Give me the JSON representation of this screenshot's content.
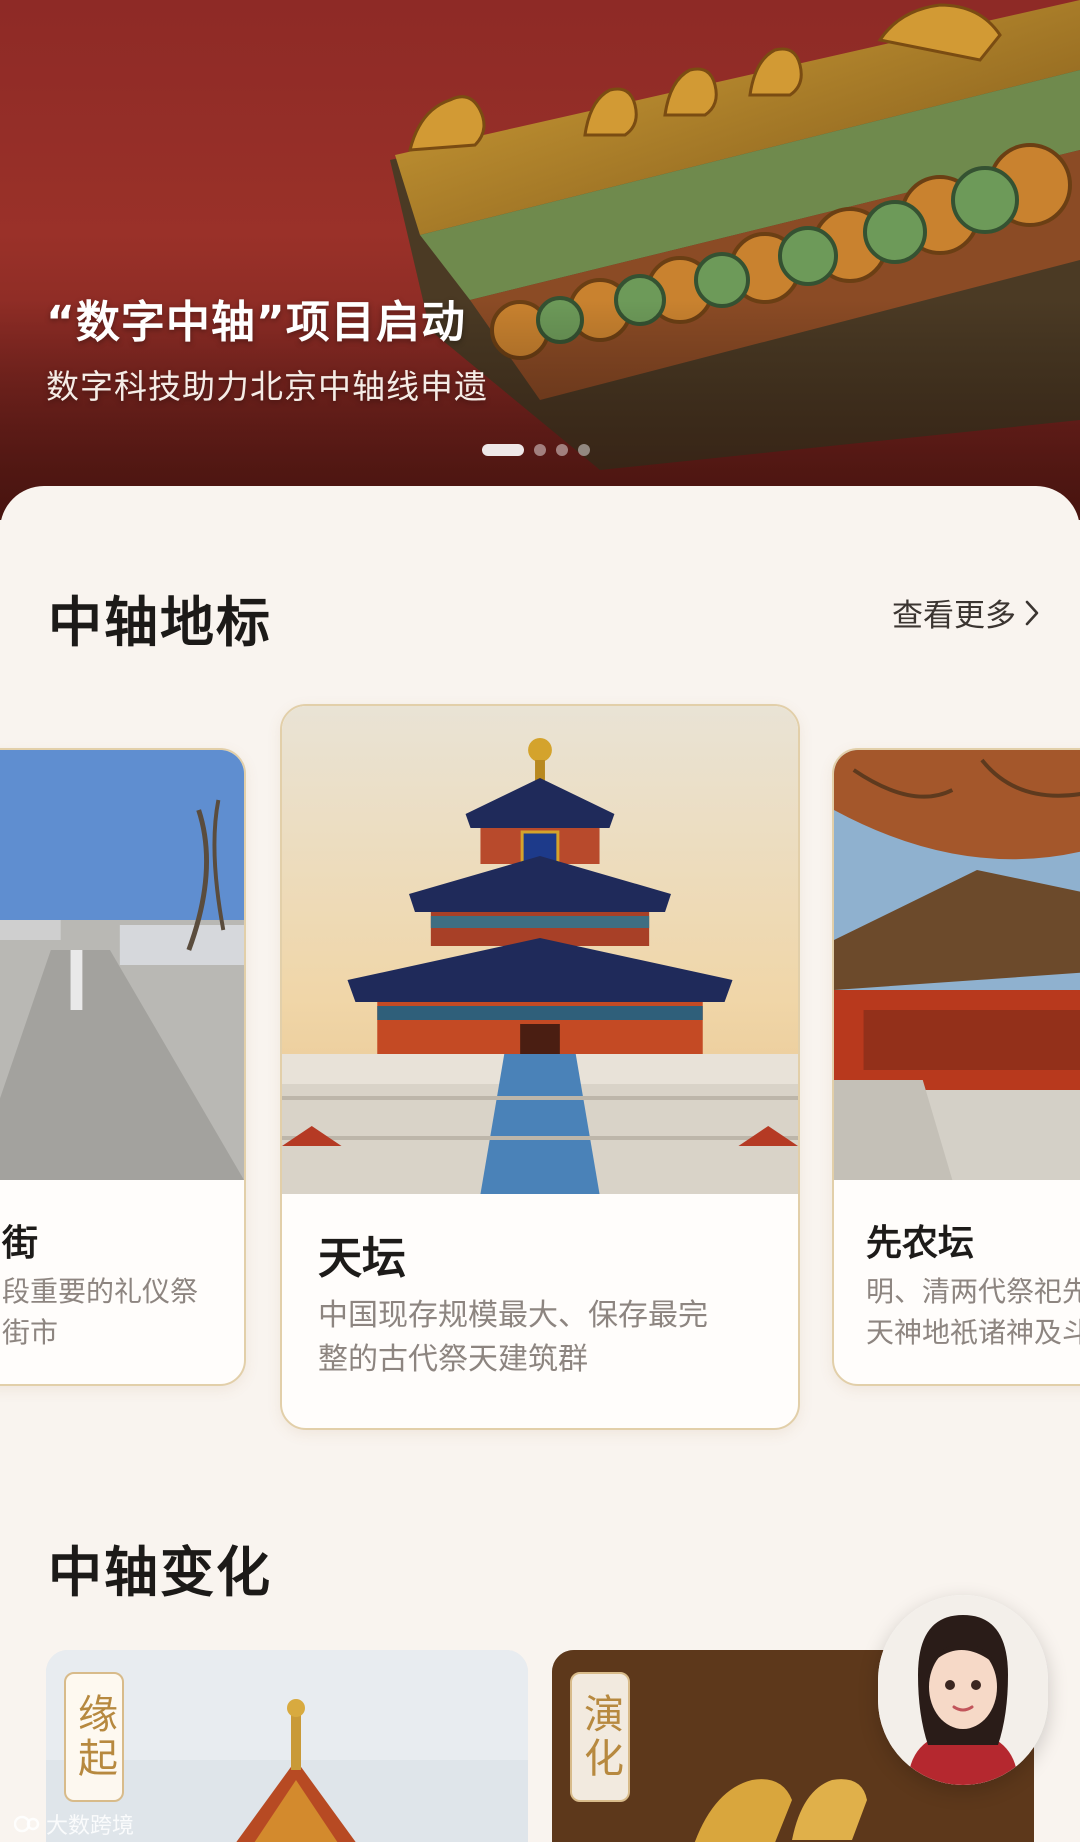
{
  "hero": {
    "title": "“数字中轴”项目启动",
    "subtitle": "数字科技助力北京中轴线申遗",
    "slide_count": 4,
    "active_slide": 1
  },
  "landmarks": {
    "section_title": "中轴地标",
    "more_label": "查看更多",
    "cards": [
      {
        "name": "街",
        "desc": "段重要的礼仪祭\n街市"
      },
      {
        "name": "天坛",
        "desc": "中国现存规模最大、保存最完\n整的古代祭天建筑群"
      },
      {
        "name": "先农坛",
        "desc": "明、清两代祭祀先\n天神地祇诸神及斗"
      }
    ]
  },
  "changes": {
    "section_title": "中轴变化",
    "tiles": [
      {
        "tag": "缘起"
      },
      {
        "tag": "演化"
      }
    ]
  },
  "watermark": "大数跨境",
  "colors": {
    "hero_red": "#8e2a26",
    "card_border": "#e2cfa9",
    "tag_gold": "#b7893f",
    "background": "#f9f4ef"
  }
}
